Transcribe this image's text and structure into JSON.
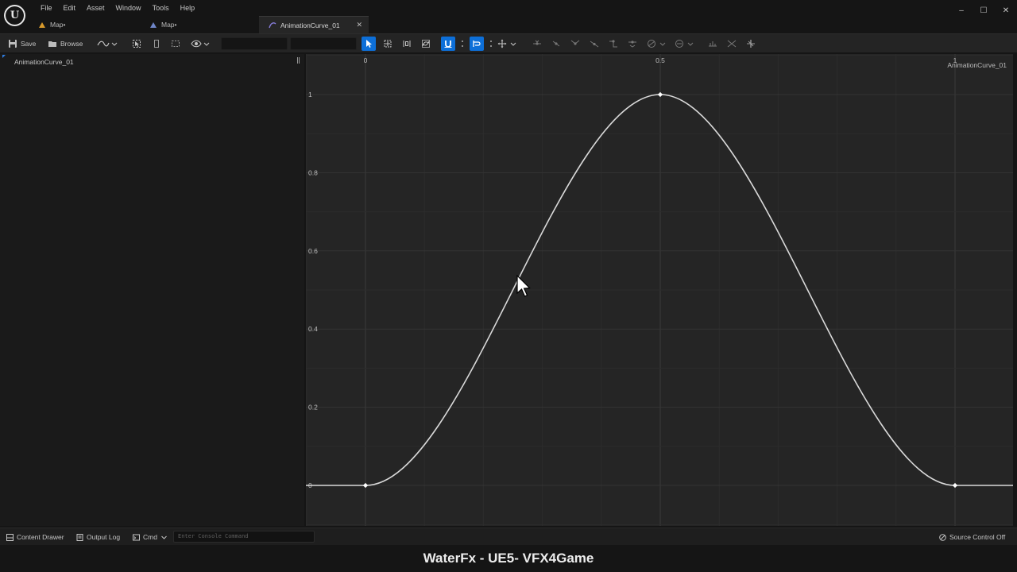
{
  "app": {
    "logo_glyph": "U",
    "menu": [
      "File",
      "Edit",
      "Asset",
      "Window",
      "Tools",
      "Help"
    ],
    "tabs": [
      {
        "label": "Map•",
        "icon": "level-map-icon"
      },
      {
        "label": "Map•",
        "icon": "level-map-icon"
      },
      {
        "label": "AnimationCurve_01",
        "icon": "curve-asset-icon",
        "active": true
      }
    ],
    "window_controls": {
      "minimize": "–",
      "maximize": "☐",
      "close": "✕"
    }
  },
  "toolbar": {
    "save_label": "Save",
    "browse_label": "Browse",
    "time_field": "",
    "value_field": ""
  },
  "left_panel": {
    "curve_name": "AnimationCurve_01"
  },
  "graph": {
    "curve_label": "AnimationCurve_01",
    "colors": {
      "curve": "#d9d9d9",
      "grid_major": "#343434",
      "grid_minor": "#2c2c2c",
      "axis_text": "#bdbdbd"
    }
  },
  "chart_data": {
    "type": "line",
    "title": "",
    "xlabel": "",
    "ylabel": "",
    "xlim": [
      -0.1,
      1.1
    ],
    "ylim": [
      -0.1,
      1.1
    ],
    "x_ticks": [
      0,
      0.5,
      1
    ],
    "x_tick_labels": [
      "0",
      "0.5",
      "1"
    ],
    "y_ticks": [
      0,
      0.2,
      0.4,
      0.6,
      0.8,
      1
    ],
    "y_tick_labels": [
      "0",
      "0.2",
      "0.4",
      "0.6",
      "0.8",
      "1"
    ],
    "grid": true,
    "series": [
      {
        "x": [
          -0.1,
          0,
          0.5,
          1,
          1.1
        ],
        "y": [
          0,
          0,
          1,
          0,
          0
        ],
        "keys": [
          {
            "x": 0,
            "y": 0
          },
          {
            "x": 0.5,
            "y": 1
          },
          {
            "x": 1,
            "y": 0
          }
        ],
        "interpolation": "cubic-auto"
      }
    ]
  },
  "statusbar": {
    "content_drawer": "Content Drawer",
    "output_log": "Output Log",
    "cmd": "Cmd",
    "console_placeholder": "Enter Console Command",
    "source_control": "Source Control Off"
  },
  "caption": "WaterFx - UE5- VFX4Game"
}
